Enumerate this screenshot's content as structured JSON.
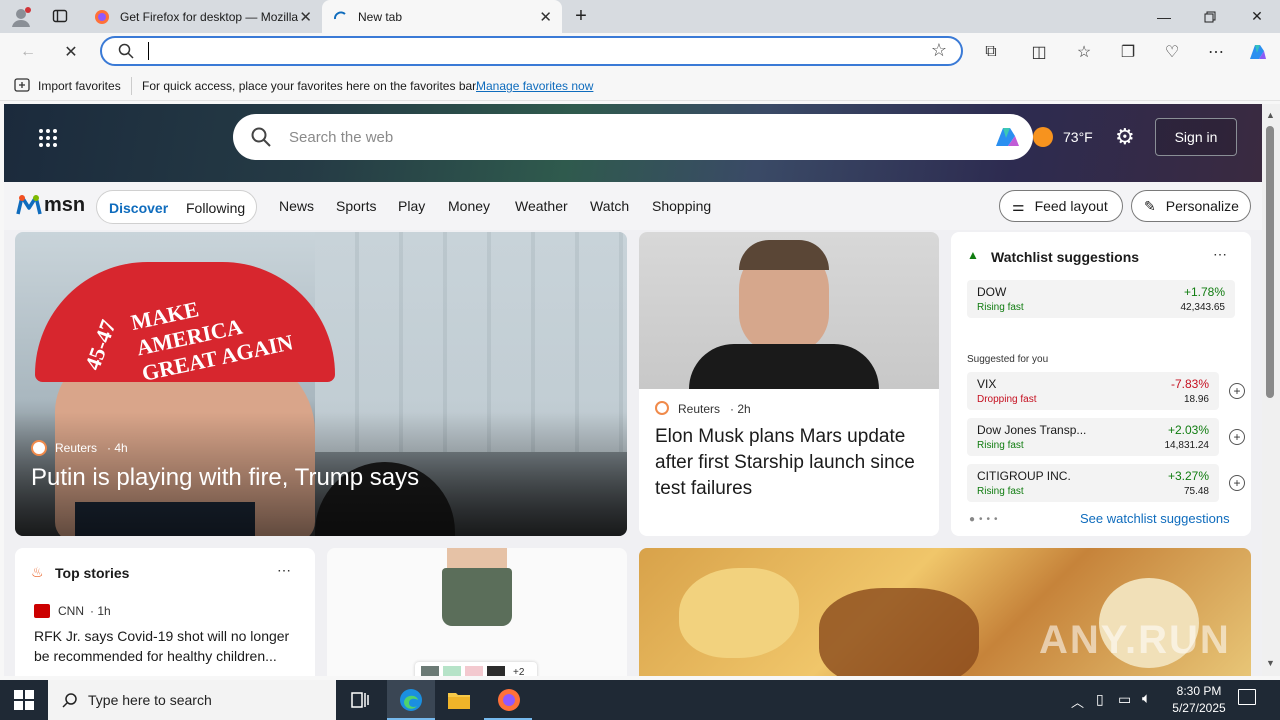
{
  "browser": {
    "tabs": [
      {
        "title": "Get Firefox for desktop — Mozilla",
        "active": false
      },
      {
        "title": "New tab",
        "active": true
      }
    ],
    "address_value": "",
    "favorites_bar": {
      "import_label": "Import favorites",
      "hint": "For quick access, place your favorites here on the favorites bar.",
      "manage_link": "Manage favorites now"
    }
  },
  "msn": {
    "search_placeholder": "Search the web",
    "weather": "73°F",
    "sign_in": "Sign in",
    "logo": "msn",
    "tabs": [
      "Discover",
      "Following"
    ],
    "nav": [
      "News",
      "Sports",
      "Play",
      "Money",
      "Weather",
      "Watch",
      "Shopping"
    ],
    "feed_layout": "Feed layout",
    "personalize": "Personalize"
  },
  "hero": {
    "source": "Reuters",
    "age": "4h",
    "headline": "Putin is playing with fire, Trump says",
    "cap_text": "MAKE AMERICA GREAT AGAIN",
    "cap_side": "45-47"
  },
  "story2": {
    "source": "Reuters",
    "age": "2h",
    "headline": "Elon Musk plans Mars update after first Starship launch since test failures"
  },
  "watchlist": {
    "title": "Watchlist suggestions",
    "suggested_label": "Suggested for you",
    "see_link": "See watchlist suggestions",
    "items": [
      {
        "name": "DOW",
        "status": "Rising fast",
        "change": "+1.78%",
        "price": "42,343.65",
        "up": true
      },
      {
        "name": "VIX",
        "status": "Dropping fast",
        "change": "-7.83%",
        "price": "18.96",
        "up": false
      },
      {
        "name": "Dow Jones Transp...",
        "status": "Rising fast",
        "change": "+2.03%",
        "price": "14,831.24",
        "up": true
      },
      {
        "name": "CITIGROUP INC.",
        "status": "Rising fast",
        "change": "+3.27%",
        "price": "75.48",
        "up": true
      }
    ]
  },
  "top_stories": {
    "title": "Top stories",
    "source": "CNN",
    "age": "1h",
    "headline": "RFK Jr. says Covid-19 shot will no longer be recommended for healthy children..."
  },
  "shorts_card": {
    "extra_count": "+2"
  },
  "watermark": "ANY.RUN",
  "taskbar": {
    "search_placeholder": "Type here to search",
    "time": "8:30 PM",
    "date": "5/27/2025"
  },
  "colors": {
    "accent": "#0f6cbd",
    "rise": "#107c10",
    "drop": "#c50f1f"
  }
}
